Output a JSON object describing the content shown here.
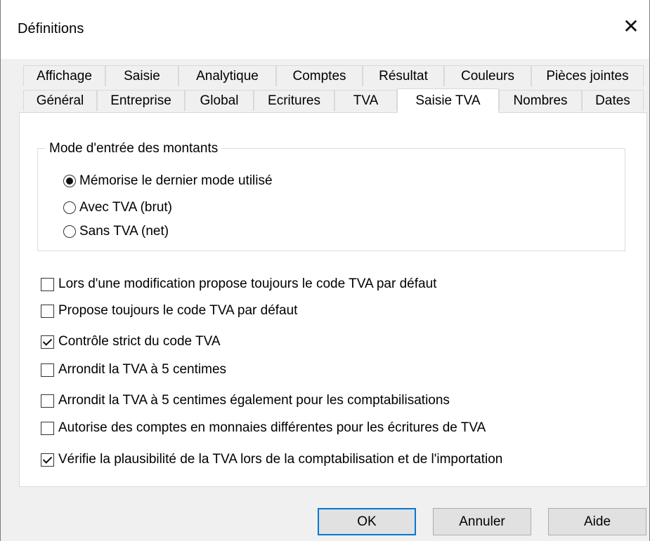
{
  "window": {
    "title": "Définitions",
    "close_glyph": "✕"
  },
  "tabs_row1": [
    "Affichage",
    "Saisie",
    "Analytique",
    "Comptes",
    "Résultat",
    "Couleurs",
    "Pièces jointes"
  ],
  "tabs_row2": [
    "Général",
    "Entreprise",
    "Global",
    "Ecritures",
    "TVA",
    "Saisie TVA",
    "Nombres",
    "Dates"
  ],
  "selected_tab": "Saisie TVA",
  "group": {
    "legend": "Mode d'entrée des montants",
    "options": [
      {
        "label": "Mémorise le dernier mode utilisé",
        "checked": true
      },
      {
        "label": "Avec TVA (brut)",
        "checked": false
      },
      {
        "label": "Sans TVA (net)",
        "checked": false
      }
    ]
  },
  "checkboxes": [
    {
      "label": "Lors d'une modification propose toujours le code TVA par défaut",
      "checked": false
    },
    {
      "label": "Propose toujours le code TVA par défaut",
      "checked": false
    },
    {
      "label": "Contrôle strict du code TVA",
      "checked": true
    },
    {
      "label": "Arrondit la TVA à 5 centimes",
      "checked": false
    },
    {
      "label": "Arrondit la TVA à 5 centimes également pour les comptabilisations",
      "checked": false
    },
    {
      "label": "Autorise des comptes en monnaies différentes pour les écritures de TVA",
      "checked": false
    },
    {
      "label": "Vérifie la plausibilité de la TVA lors de la comptabilisation et de l'importation",
      "checked": true
    }
  ],
  "buttons": {
    "ok": "OK",
    "cancel": "Annuler",
    "help": "Aide"
  },
  "colors": {
    "default_button_border": "#0078d7",
    "dialog_background": "#f0f0f0",
    "panel_background": "#ffffff"
  }
}
